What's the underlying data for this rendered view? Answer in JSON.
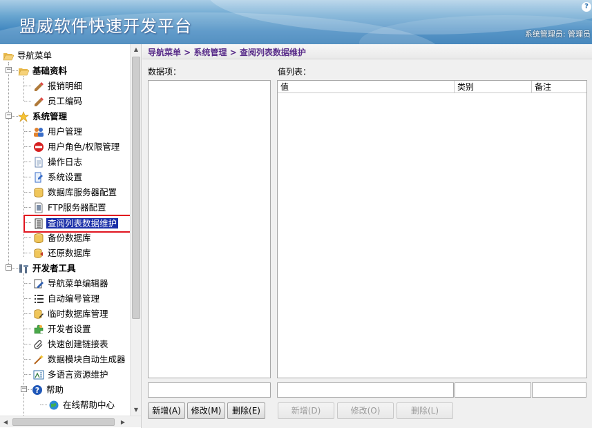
{
  "header": {
    "title": "盟威软件快速开发平台",
    "user_text": "系统管理员: 管理员",
    "help_glyph": "?"
  },
  "breadcrumb": "导航菜单 > 系统管理 > 查阅列表数据维护",
  "tree": {
    "root": "导航菜单",
    "groups": [
      {
        "label": "基础资料",
        "items": [
          "报销明细",
          "员工编码"
        ]
      },
      {
        "label": "系统管理",
        "items": [
          "用户管理",
          "用户角色/权限管理",
          "操作日志",
          "系统设置",
          "数据库服务器配置",
          "FTP服务器配置",
          "查阅列表数据维护",
          "备份数据库",
          "还原数据库"
        ]
      },
      {
        "label": "开发者工具",
        "items": [
          "导航菜单编辑器",
          "自动编号管理",
          "临时数据库管理",
          "开发者设置",
          "快速创建链接表",
          "数据模块自动生成器",
          "多语言资源维护"
        ]
      },
      {
        "label": "帮助",
        "items": [
          "在线帮助中心"
        ]
      }
    ],
    "selected_item": "查阅列表数据维护"
  },
  "left_pane": {
    "label": "数据项：",
    "buttons": {
      "add": "新增(A)",
      "edit": "修改(M)",
      "delete": "删除(E)"
    }
  },
  "right_pane": {
    "label": "值列表：",
    "columns": [
      "值",
      "类别",
      "备注"
    ],
    "buttons": {
      "add": "新增(D)",
      "edit": "修改(O)",
      "delete": "删除(L)"
    }
  },
  "colors": {
    "accent": "#5a2e8a",
    "selection": "#1a2fa8",
    "highlight_border": "#e0141e"
  }
}
